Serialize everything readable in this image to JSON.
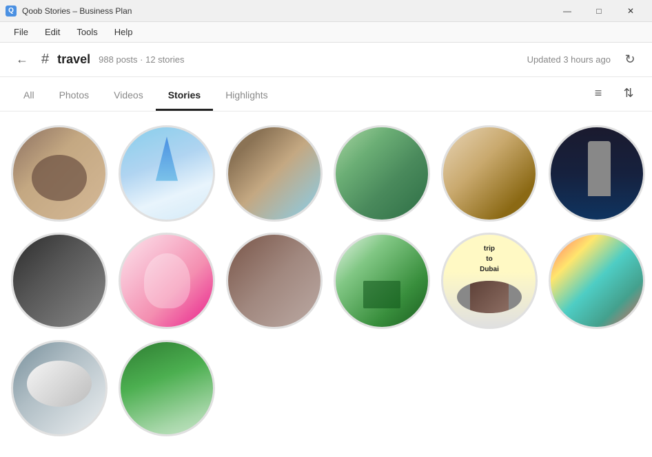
{
  "titleBar": {
    "icon": "Q",
    "title": "Qoob Stories – Business Plan",
    "minimize": "—",
    "maximize": "□",
    "close": "✕"
  },
  "menuBar": {
    "items": [
      "File",
      "Edit",
      "Tools",
      "Help"
    ]
  },
  "navBar": {
    "back": "←",
    "hash": "#",
    "tag": "travel",
    "meta": "988 posts · 12 stories",
    "updatedLabel": "Updated 3 hours ago",
    "refresh": "↻"
  },
  "tabs": {
    "items": [
      {
        "label": "All",
        "active": false
      },
      {
        "label": "Photos",
        "active": false
      },
      {
        "label": "Videos",
        "active": false
      },
      {
        "label": "Stories",
        "active": true
      },
      {
        "label": "Highlights",
        "active": false
      }
    ],
    "sortIcon": "≡",
    "filterIcon": "⇅"
  },
  "stories": {
    "items": [
      {
        "id": 1,
        "class": "img-1"
      },
      {
        "id": 2,
        "class": "img-2"
      },
      {
        "id": 3,
        "class": "img-3"
      },
      {
        "id": 4,
        "class": "img-4"
      },
      {
        "id": 5,
        "class": "img-5"
      },
      {
        "id": 6,
        "class": "img-6"
      },
      {
        "id": 7,
        "class": "img-7"
      },
      {
        "id": 8,
        "class": "img-8"
      },
      {
        "id": 9,
        "class": "img-9"
      },
      {
        "id": 10,
        "class": "img-10"
      },
      {
        "id": 11,
        "class": "img-11"
      },
      {
        "id": 12,
        "class": "img-12"
      },
      {
        "id": 13,
        "class": "img-13"
      },
      {
        "id": 14,
        "class": "img-14"
      },
      {
        "id": 15,
        "class": "img-15"
      },
      {
        "id": 16,
        "class": "img-16"
      }
    ]
  }
}
